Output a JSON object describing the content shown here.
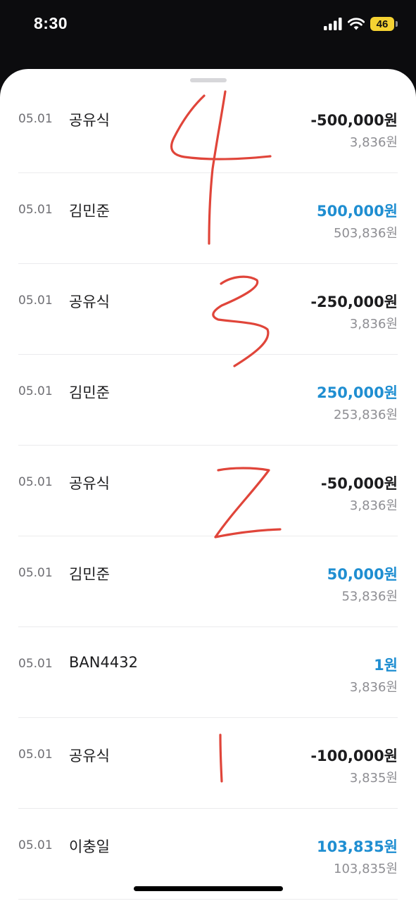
{
  "status_bar": {
    "time": "8:30",
    "battery": "46",
    "icons": [
      "signal-icon",
      "wifi-icon",
      "battery-icon"
    ]
  },
  "transactions": [
    {
      "date": "05.01",
      "name": "공유식",
      "amount": "-500,000원",
      "balance": "3,836원",
      "direction": "out"
    },
    {
      "date": "05.01",
      "name": "김민준",
      "amount": "500,000원",
      "balance": "503,836원",
      "direction": "in"
    },
    {
      "date": "05.01",
      "name": "공유식",
      "amount": "-250,000원",
      "balance": "3,836원",
      "direction": "out"
    },
    {
      "date": "05.01",
      "name": "김민준",
      "amount": "250,000원",
      "balance": "253,836원",
      "direction": "in"
    },
    {
      "date": "05.01",
      "name": "공유식",
      "amount": "-50,000원",
      "balance": "3,836원",
      "direction": "out"
    },
    {
      "date": "05.01",
      "name": "김민준",
      "amount": "50,000원",
      "balance": "53,836원",
      "direction": "in"
    },
    {
      "date": "05.01",
      "name": "BAN4432",
      "amount": "1원",
      "balance": "3,836원",
      "direction": "in"
    },
    {
      "date": "05.01",
      "name": "공유식",
      "amount": "-100,000원",
      "balance": "3,835원",
      "direction": "out"
    },
    {
      "date": "05.01",
      "name": "이충일",
      "amount": "103,835원",
      "balance": "103,835원",
      "direction": "in"
    }
  ],
  "annotations": {
    "color": "#e0453a",
    "marks": [
      "4",
      "3",
      "2",
      "1"
    ]
  },
  "colors": {
    "incoming": "#1f8ed1",
    "outgoing": "#1c1c1e",
    "secondary": "#8e8e93",
    "battery": "#f5d232"
  }
}
